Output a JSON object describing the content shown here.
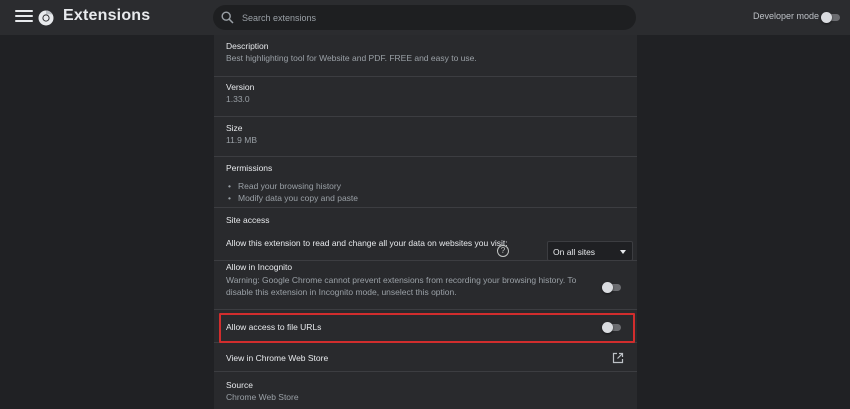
{
  "header": {
    "title": "Extensions",
    "search_placeholder": "Search extensions",
    "developer_mode_label": "Developer mode",
    "developer_mode_on": false
  },
  "details": {
    "description": {
      "label": "Description",
      "value": "Best highlighting tool for Website and PDF. FREE and easy to use."
    },
    "version": {
      "label": "Version",
      "value": "1.33.0"
    },
    "size": {
      "label": "Size",
      "value": "11.9 MB"
    },
    "permissions": {
      "label": "Permissions",
      "items": [
        "Read your browsing history",
        "Modify data you copy and paste"
      ]
    },
    "site_access": {
      "label": "Site access",
      "prompt": "Allow this extension to read and change all your data on websites you visit:",
      "selected": "On all sites"
    },
    "incognito": {
      "label": "Allow in Incognito",
      "warning": "Warning: Google Chrome cannot prevent extensions from recording your browsing history. To disable this extension in Incognito mode, unselect this option.",
      "enabled": false
    },
    "file_urls": {
      "label": "Allow access to file URLs",
      "enabled": false
    },
    "web_store": {
      "label": "View in Chrome Web Store"
    },
    "source": {
      "label": "Source",
      "value": "Chrome Web Store"
    }
  },
  "colors": {
    "background": "#202124",
    "header": "#2b2c2f",
    "card": "#292a2d",
    "highlight_border": "#d12d2d"
  },
  "icons": [
    "menu-icon",
    "chrome-logo-icon",
    "search-icon",
    "help-icon",
    "dropdown-arrow-icon",
    "open-in-new-icon"
  ]
}
